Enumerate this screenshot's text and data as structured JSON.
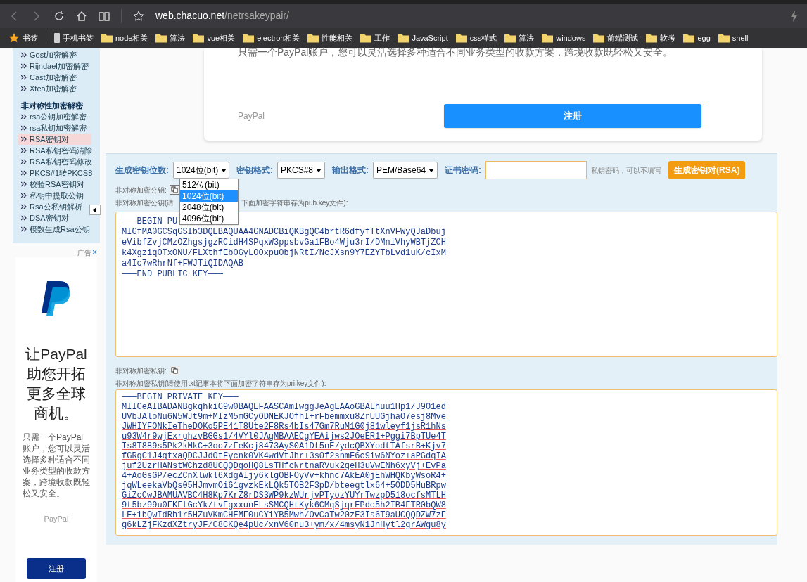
{
  "browser": {
    "url_domain": "web.chacuo.net",
    "url_path": "/netrsakeypair/"
  },
  "bookmarks": [
    {
      "label": "书签",
      "kind": "star"
    },
    {
      "label": "手机书签",
      "kind": "phone"
    },
    {
      "label": "node相关",
      "kind": "folder"
    },
    {
      "label": "算法",
      "kind": "folder"
    },
    {
      "label": "vue相关",
      "kind": "folder"
    },
    {
      "label": "electron相关",
      "kind": "folder"
    },
    {
      "label": "性能相关",
      "kind": "folder"
    },
    {
      "label": "工作",
      "kind": "folder"
    },
    {
      "label": "JavaScript",
      "kind": "folder"
    },
    {
      "label": "css样式",
      "kind": "folder"
    },
    {
      "label": "算法",
      "kind": "folder"
    },
    {
      "label": "windows",
      "kind": "folder"
    },
    {
      "label": "前端测试",
      "kind": "folder"
    },
    {
      "label": "软考",
      "kind": "folder"
    },
    {
      "label": "egg",
      "kind": "folder"
    },
    {
      "label": "shell",
      "kind": "folder"
    }
  ],
  "sidebar": {
    "items_top": [
      "Gost加密解密",
      "Rijndael加密解密",
      "Cast加密解密",
      "Xtea加密解密"
    ],
    "section_title": "非对称性加密解密",
    "items": [
      {
        "label": "rsa公钥加密解密",
        "selected": false
      },
      {
        "label": "rsa私钥加密解密",
        "selected": false
      },
      {
        "label": "RSA密钥对",
        "selected": true
      },
      {
        "label": "RSA私钥密码清除",
        "selected": false
      },
      {
        "label": "RSA私钥密码修改",
        "selected": false
      },
      {
        "label": "PKCS#1转PKCS8",
        "selected": false
      },
      {
        "label": "校验RSA密钥对",
        "selected": false
      },
      {
        "label": "私钥中提取公钥",
        "selected": false
      },
      {
        "label": "Rsa公私钥解析",
        "selected": false
      },
      {
        "label": "DSA密钥对",
        "selected": false
      },
      {
        "label": "模数生成Rsa公钥",
        "selected": false
      }
    ]
  },
  "side_ad": {
    "label": "广告",
    "close": "×",
    "headline": [
      "让PayPal",
      "助您开拓",
      "更多全球",
      "商机。"
    ],
    "body": "只需一个PayPal账户，您可以灵活选择多种适合不同业务类型的收款方案，跨境收款既轻松又安全。",
    "brand": "PayPal",
    "button": "注册"
  },
  "top_ad": {
    "text": "只需一个PayPal账户，您可以灵活选择多种适合不同业务类型的收款方案，跨境收款既轻松又安全。",
    "brand": "PayPal",
    "button": "注册"
  },
  "form": {
    "fields": [
      {
        "label": "生成密钥位数:",
        "value": "1024位(bit)",
        "kind": "select"
      },
      {
        "label": "密钥格式:",
        "value": "PKCS#8",
        "kind": "select"
      },
      {
        "label": "输出格式:",
        "value": "PEM/Base64",
        "kind": "select"
      },
      {
        "label": "证书密码:",
        "kind": "input"
      }
    ],
    "hint": "私钥密码，可以不填写",
    "generate_button": "生成密钥对(RSA)",
    "dropdown": {
      "expanded": true,
      "options": [
        {
          "label": "512位(bit)",
          "selected": false
        },
        {
          "label": "1024位(bit)",
          "selected": true
        },
        {
          "label": "2048位(bit)",
          "selected": false
        },
        {
          "label": "4096位(bit)",
          "selected": false
        }
      ]
    }
  },
  "public_key": {
    "copy_label": "非对称加密公钥:",
    "note_start": "非对称加密公钥(请",
    "note_end": "下面加密字符串存为pub.key文件):",
    "lines": [
      "———BEGIN PU",
      "MIGfMA0GCSqGSIb3DQEBAQUAA4GNADCBiQKBgQC4brtR6dfyfTtXnVFWyQJaDbuj",
      "eVibfZvjCMzOZhgsjgzRCidH4SPqxW3ppsbvGa1FBo4Wju3rI/DMniVhyWBTjZCH",
      "k4XgziqOTxONU/FLXthfEbOGyLOOxpuObjNRtI/NcJXsn9Y7EZYTbLvd1uK/cIxM",
      "a4Ic7wRhrNf+FWJTiQIDAQAB",
      "———END PUBLIC KEY———"
    ]
  },
  "private_key": {
    "copy_label": "非对称加密私钥:",
    "note": "非对称加密私钥(请使用txt记事本将下面加密字符串存为pri.key文件):",
    "lines": [
      "———BEGIN PRIVATE KEY———",
      "MIICeAIBADANBgkqhkiG9w0BAQEFAASCAmIwggJeAgEAAoGBALhuu1Hp1/J9O1ed",
      "UVbJAloNu6N5WJt9m+MIzM5mGCyODNEKJOfhI+rFbemmxu8ZrUUGjhaO7esj8Mve",
      "JWHIYFONkIeTheDOKo5PE41T8Ute2F8Rs4bIs47Gm7RuM1G0j81wleyf1jsR1hNs",
      "u93W4r9wjExrghzvBGGs1/4VYl0JAgMBAAECgYEAijws2JOeER1+Pggi7BpTUe4T",
      "Is8T889s5Pk2kMkC+3oo7zFeKcj8473AyS0A1Dt5nE/ydcQBXYodtTAfsrB+Kjv7",
      "fGRgC1J4qtxaQDCJJdOtFycnk0VK4wdVtJhr+3s0f2snmF6c9iw6NYoz+aPGdqIA",
      "juf2UzrHANstWChzd8UCQQDgoHQ8LsTHfcNrtnaRVuk2geH3uVwENh6xyVj+EvPa",
      "4+AoGsGP/ecZCnXlwkl6XdgAIjy6klgOBFOyVv+khnc7AkEA0jEhWHQKbyWsoR4+",
      "jqWLeekaVbQs05HJmvmOi61gvzkEkLQk5TOB2F3pD/bteegtlx64+5ODD5HuBRpw",
      "GiZcCwJBAMUAVBC4H8Kp7KrZ8rDS3WP9kzWUrjvPTyozYUYrTwzpD518ocfsMTLH",
      "9t5bz99u0FKFtGcYk/tvFgxxunELsSMCQHtKyk6CMqSjqrEPdo5h2IB4FTR0bQW8",
      "LE+1bQwIdRh1r5HZuVKmCHEMF0uCYiYB5Mwh/OvCaTw20zE3Is6T9aUCQQDZW7zF",
      "g6kLZjFKzdXZtryJF/C8CKQe4pUc/xnV60nu3+ym/x/4msyN1JnHytl2grAWgu8y"
    ]
  }
}
